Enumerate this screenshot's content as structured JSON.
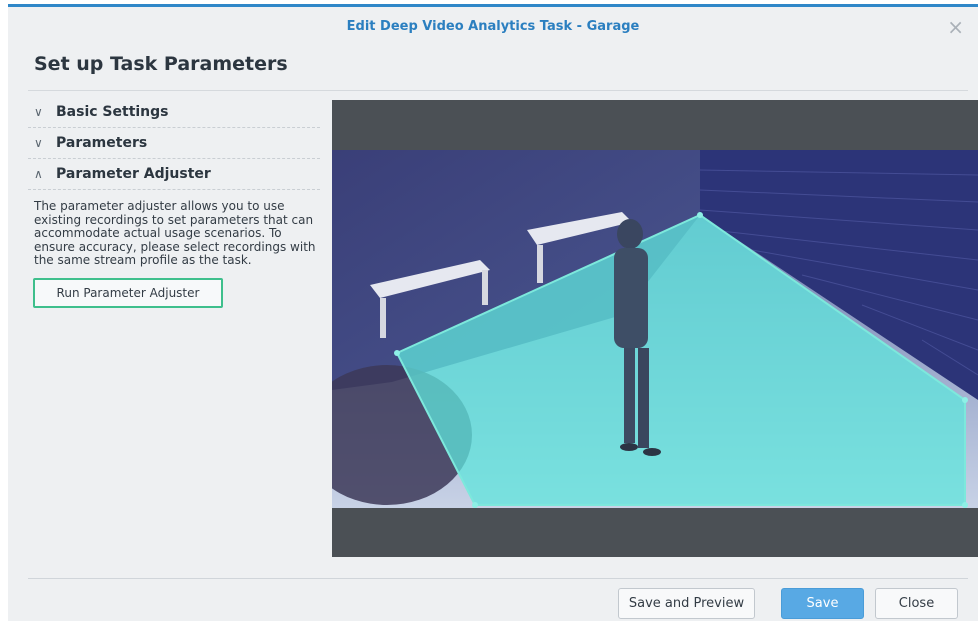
{
  "dialog": {
    "title": "Edit Deep Video Analytics Task - Garage",
    "close_glyph": "×",
    "heading": "Set up Task Parameters"
  },
  "sections": [
    {
      "label": "Basic Settings",
      "chevron": "∨",
      "expanded": false
    },
    {
      "label": "Parameters",
      "chevron": "∨",
      "expanded": false
    },
    {
      "label": "Parameter Adjuster",
      "chevron": "∧",
      "expanded": true
    }
  ],
  "adjuster": {
    "description": "The parameter adjuster allows you to use existing recordings to set parameters that can accommodate actual usage scenarios. To ensure accuracy, please select recordings with the same stream profile as the task.",
    "run_button": "Run Parameter Adjuster"
  },
  "footer": {
    "save_preview": "Save and Preview",
    "save": "Save",
    "close": "Close"
  },
  "colors": {
    "accent": "#2b7fc0",
    "detection_zone": "#5fe6dc",
    "primary_button": "#58a9e4",
    "run_button_border": "#3ebf8c"
  },
  "icons": [
    "close-icon",
    "chevron-down-icon",
    "chevron-up-icon"
  ]
}
